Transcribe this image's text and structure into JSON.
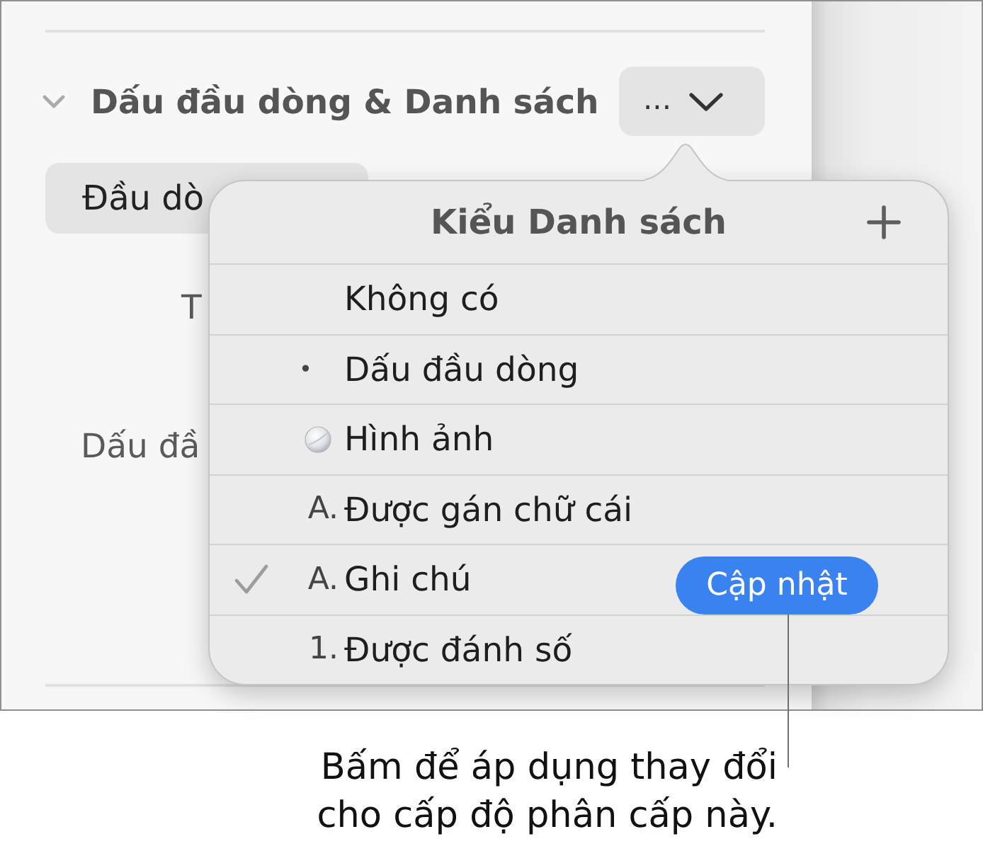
{
  "sidebar": {
    "section": {
      "title": "Dấu đầu dòng & Danh sách",
      "expanded": true,
      "menu_button": {
        "label": "..."
      }
    },
    "style_field": {
      "value": "Đầu dò"
    },
    "labels": [
      "T",
      "Dấu đầ"
    ]
  },
  "popover": {
    "title": "Kiểu Danh sách",
    "items": [
      {
        "kind": "none",
        "label": "Không có",
        "selected": false
      },
      {
        "kind": "bullet",
        "marker": "•",
        "label": "Dấu đầu dòng",
        "selected": false
      },
      {
        "kind": "image",
        "label": "Hình ảnh",
        "selected": false
      },
      {
        "kind": "text",
        "marker": "A.",
        "label": "Được gán chữ cái",
        "selected": false
      },
      {
        "kind": "text",
        "marker": "A.",
        "label": "Ghi chú",
        "selected": true,
        "action": "Cập nhật"
      },
      {
        "kind": "text",
        "marker": "1.",
        "label": "Được đánh số",
        "selected": false
      }
    ]
  },
  "callout": {
    "text": "Bấm để áp dụng thay đổi cho cấp độ phân cấp này."
  }
}
